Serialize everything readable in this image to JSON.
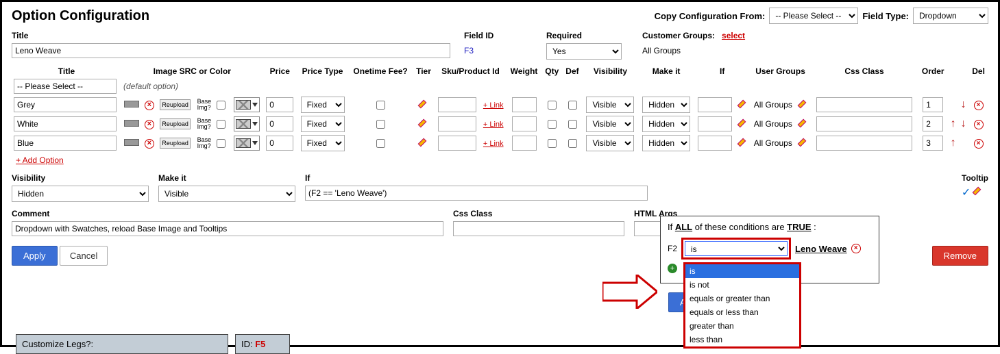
{
  "header": {
    "title": "Option Configuration",
    "copy_from_label": "Copy Configuration From:",
    "copy_from_value": "-- Please Select --",
    "field_type_label": "Field Type:",
    "field_type_value": "Dropdown"
  },
  "top_fields": {
    "title_label": "Title",
    "title_value": "Leno Weave",
    "fieldid_label": "Field ID",
    "fieldid_value": "F3",
    "required_label": "Required",
    "required_value": "Yes",
    "cust_groups_label": "Customer Groups:",
    "cust_groups_link": "select",
    "cust_groups_value": "All Groups"
  },
  "columns": {
    "title": "Title",
    "image": "Image SRC or Color",
    "price": "Price",
    "pricetype": "Price Type",
    "onetime": "Onetime Fee?",
    "tier": "Tier",
    "sku": "Sku/Product Id",
    "weight": "Weight",
    "qty": "Qty",
    "def": "Def",
    "visibility": "Visibility",
    "makeit": "Make it",
    "if": "If",
    "usergroups": "User Groups",
    "cssclass": "Css Class",
    "order": "Order",
    "del": "Del"
  },
  "default_row": {
    "title": "-- Please Select --",
    "note": "(default option)"
  },
  "rows": [
    {
      "title": "Grey",
      "reupload": "Reupload",
      "baseimg": "Base Img?",
      "price": "0",
      "pricetype": "Fixed",
      "link": "+ Link",
      "vis": "Visible",
      "makeit": "Hidden",
      "usergroups": "All Groups",
      "order": "1",
      "show_up": false,
      "show_down": true
    },
    {
      "title": "White",
      "reupload": "Reupload",
      "baseimg": "Base Img?",
      "price": "0",
      "pricetype": "Fixed",
      "link": "+ Link",
      "vis": "Visible",
      "makeit": "Hidden",
      "usergroups": "All Groups",
      "order": "2",
      "show_up": true,
      "show_down": true
    },
    {
      "title": "Blue",
      "reupload": "Reupload",
      "baseimg": "Base Img?",
      "price": "0",
      "pricetype": "Fixed",
      "link": "+ Link",
      "vis": "Visible",
      "makeit": "Hidden",
      "usergroups": "All Groups",
      "order": "3",
      "show_up": true,
      "show_down": false
    }
  ],
  "add_option": "+ Add Option",
  "second": {
    "visibility_label": "Visibility",
    "visibility_value": "Hidden",
    "makeit_label": "Make it",
    "makeit_value": "Visible",
    "if_label": "If",
    "if_value": "(F2 == 'Leno Weave')",
    "tooltip_label": "Tooltip"
  },
  "third": {
    "comment_label": "Comment",
    "comment_value": "Dropdown with Swatches, reload Base Image and Tooltips",
    "cssclass_label": "Css Class",
    "htmlargs_label": "HTML Args"
  },
  "buttons": {
    "apply": "Apply",
    "cancel": "Cancel",
    "remove": "Remove"
  },
  "popup": {
    "line_prefix": "If ",
    "all": "ALL",
    "line_mid": " of these conditions are ",
    "true": "TRUE",
    "line_suffix": " :",
    "field": "F2",
    "sel_value": "is",
    "value_text": "Leno Weave",
    "options": [
      "is",
      "is not",
      "equals or greater than",
      "equals or less than",
      "greater than",
      "less than"
    ]
  },
  "lower": {
    "customize": "Customize Legs?:",
    "id_label": "ID: ",
    "id_value": "F5"
  }
}
